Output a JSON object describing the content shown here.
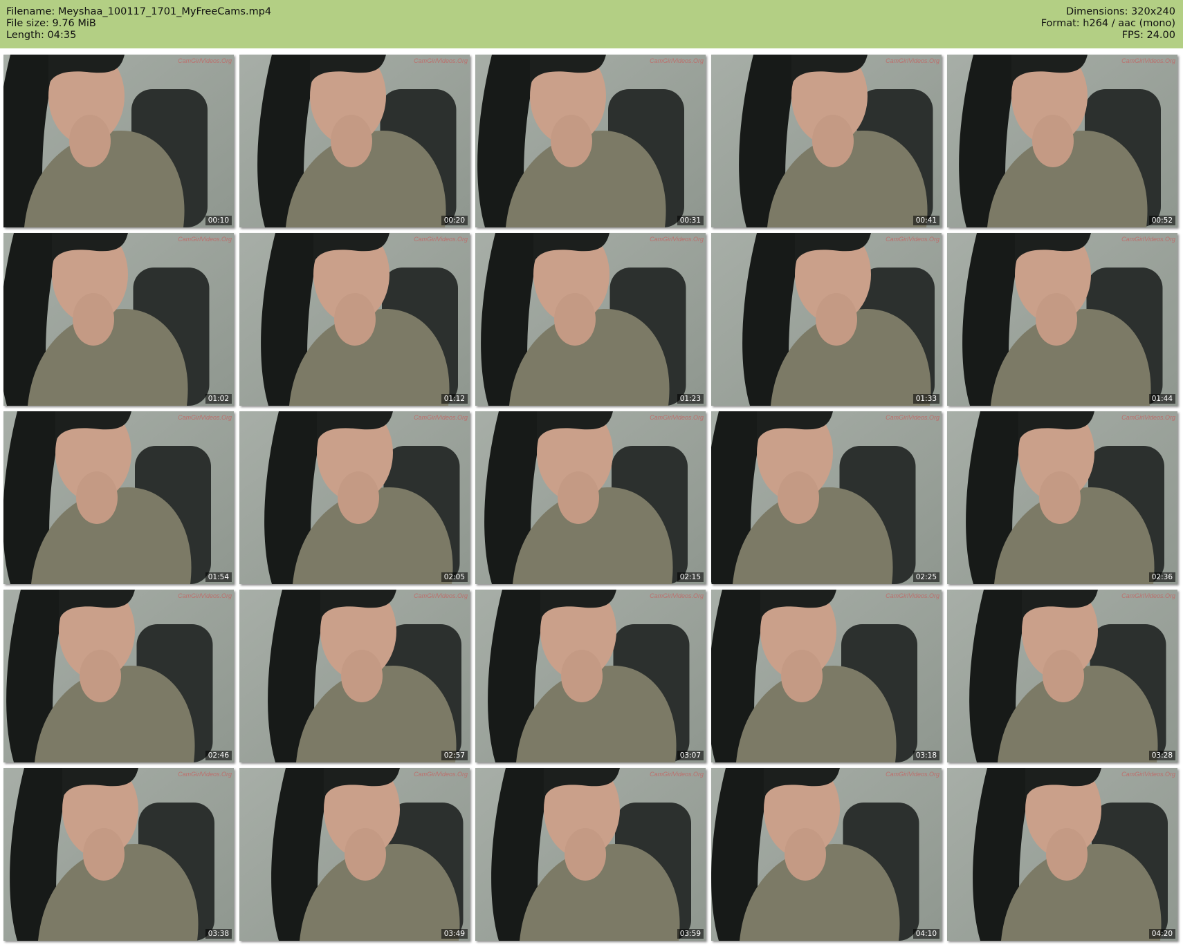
{
  "header": {
    "filename": "Filename: Meyshaa_100117_1701_MyFreeCams.mp4",
    "file_size": "File size: 9.76 MiB",
    "length": "Length: 04:35",
    "dimensions": "Dimensions: 320x240",
    "format": "Format: h264 / aac (mono)",
    "fps": "FPS: 24.00"
  },
  "watermark": "CamGirlVideos.Org",
  "colors": {
    "header_bg": "#b3cf84"
  },
  "thumbnails": [
    "00:10",
    "00:20",
    "00:31",
    "00:41",
    "00:52",
    "01:02",
    "01:12",
    "01:23",
    "01:33",
    "01:44",
    "01:54",
    "02:05",
    "02:15",
    "02:25",
    "02:36",
    "02:46",
    "02:57",
    "03:07",
    "03:18",
    "03:28",
    "03:38",
    "03:49",
    "03:59",
    "04:10",
    "04:20"
  ]
}
